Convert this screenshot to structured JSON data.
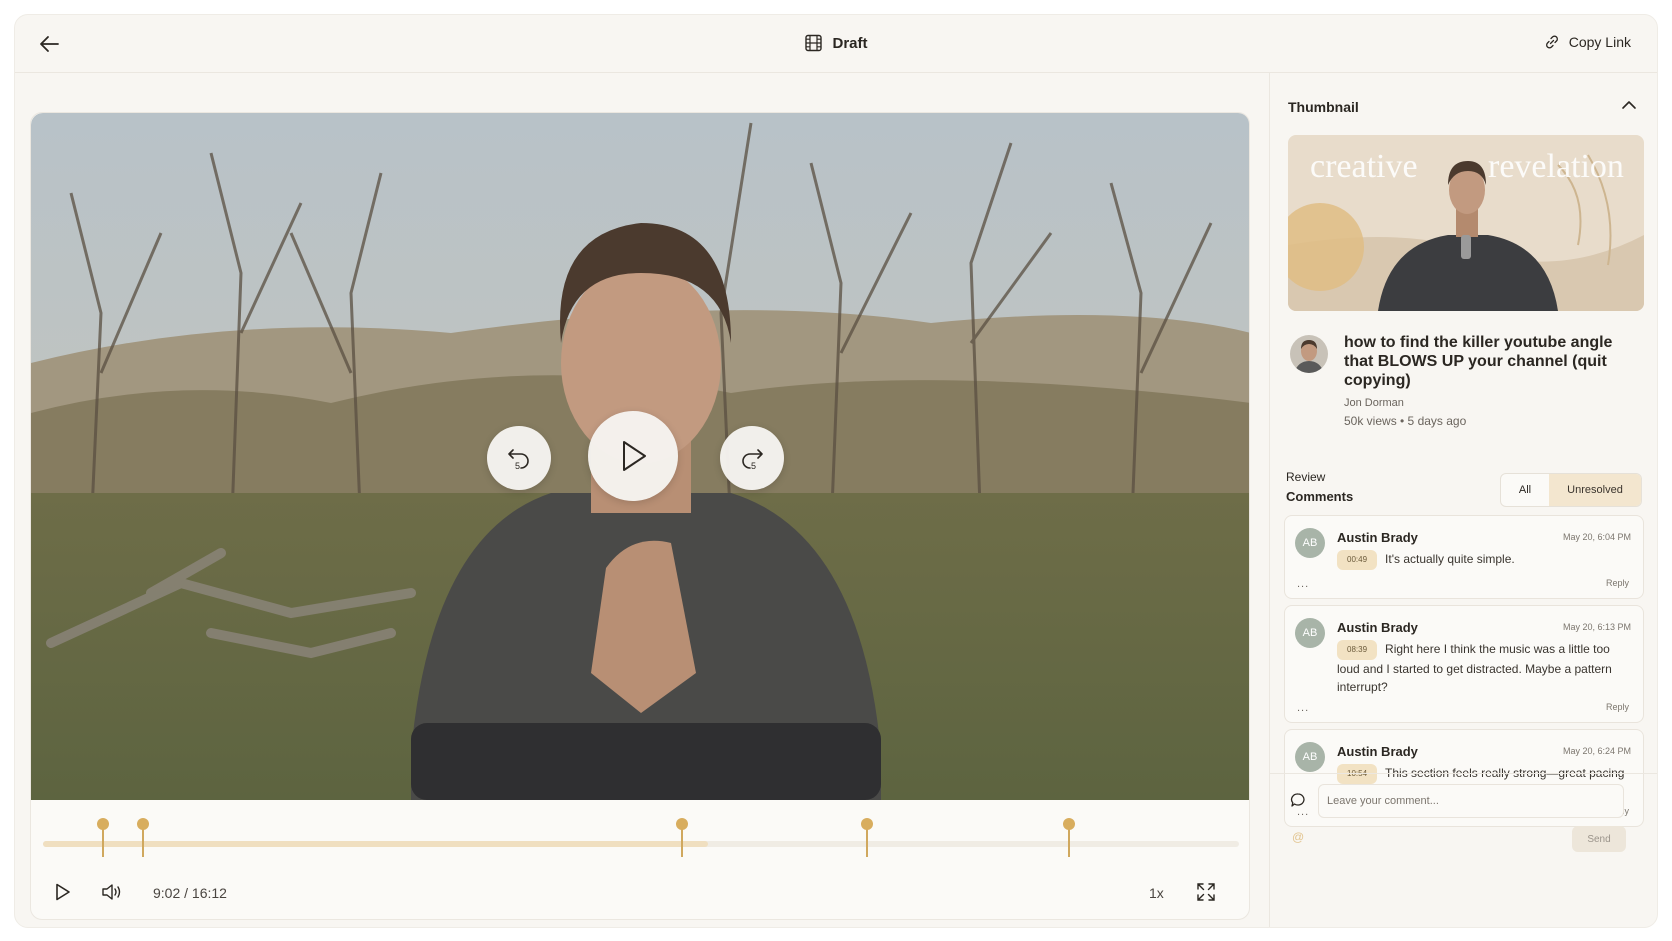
{
  "header": {
    "title": "Draft",
    "copy_link_label": "Copy Link"
  },
  "player": {
    "current_time": "9:02",
    "duration": "16:12",
    "time_display": "9:02 / 16:12",
    "speed": "1x",
    "progress_fraction": 0.556,
    "rewind_seconds": "5",
    "forward_seconds": "5",
    "comment_markers_sec": [
      49,
      81,
      519,
      670,
      834
    ]
  },
  "thumbnail_section": {
    "heading": "Thumbnail",
    "overlay_left": "creative",
    "overlay_right": "revelation",
    "video_title": "how to find the killer youtube angle that BLOWS UP your channel (quit copying)",
    "channel_name": "Jon Dorman",
    "views_line": "50k views • 5 days ago"
  },
  "review": {
    "title_line1": "Review",
    "title_line2": "Comments",
    "filter_all": "All",
    "filter_unresolved": "Unresolved",
    "comments": [
      {
        "initials": "AB",
        "author": "Austin Brady",
        "date": "May 20, 6:04 PM",
        "timestamp": "00:49",
        "text": "It's actually quite simple.",
        "more": "...",
        "reply": "Reply"
      },
      {
        "initials": "AB",
        "author": "Austin Brady",
        "date": "May 20, 6:13 PM",
        "timestamp": "08:39",
        "text": "Right here I think the music was a little too loud and I started to get distracted. Maybe a pattern interrupt?",
        "more": "...",
        "reply": "Reply"
      },
      {
        "initials": "AB",
        "author": "Austin Brady",
        "date": "May 20, 6:24 PM",
        "timestamp": "10:54",
        "text": "This section feels really strong—great pacing and message.",
        "more": "...",
        "reply": "Reply"
      }
    ]
  },
  "composer": {
    "placeholder": "Leave your comment...",
    "mention_symbol": "@",
    "send_label": "Send"
  },
  "colors": {
    "accent": "#d8ad5e",
    "accent_soft": "#f3e6cf",
    "background": "#f8f6f2"
  }
}
